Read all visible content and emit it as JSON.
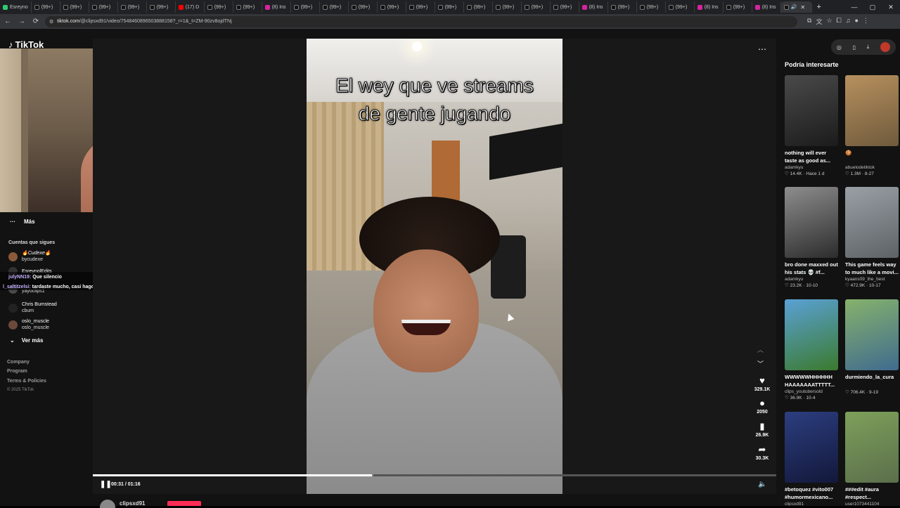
{
  "browser": {
    "tabs": [
      {
        "label": "Esreyno",
        "fav": "#2ecc71"
      },
      {
        "label": "(99+)",
        "fav": "#000"
      },
      {
        "label": "(99+)",
        "fav": "#000"
      },
      {
        "label": "(99+)",
        "fav": "#000"
      },
      {
        "label": "(99+)",
        "fav": "#000"
      },
      {
        "label": "(99+)",
        "fav": "#000"
      },
      {
        "label": "(17) D",
        "fav": "#ff0000"
      },
      {
        "label": "(99+)",
        "fav": "#000"
      },
      {
        "label": "(99+)",
        "fav": "#000"
      },
      {
        "label": "(8) Ins",
        "fav": "#d6249f"
      },
      {
        "label": "(99+)",
        "fav": "#000"
      },
      {
        "label": "(99+)",
        "fav": "#000"
      },
      {
        "label": "(99+)",
        "fav": "#000"
      },
      {
        "label": "(99+)",
        "fav": "#000"
      },
      {
        "label": "(99+)",
        "fav": "#000"
      },
      {
        "label": "(99+)",
        "fav": "#000"
      },
      {
        "label": "(99+)",
        "fav": "#000"
      },
      {
        "label": "(99+)",
        "fav": "#000"
      },
      {
        "label": "(99+)",
        "fav": "#000"
      },
      {
        "label": "(99+)",
        "fav": "#000"
      },
      {
        "label": "(8) Ins",
        "fav": "#d6249f"
      },
      {
        "label": "(99+)",
        "fav": "#000"
      },
      {
        "label": "(99+)",
        "fav": "#000"
      },
      {
        "label": "(99+)",
        "fav": "#000"
      },
      {
        "label": "(8) Ins",
        "fav": "#d6249f"
      },
      {
        "label": "(99+)",
        "fav": "#000"
      },
      {
        "label": "(8) Ins",
        "fav": "#d6249f"
      }
    ],
    "url_host": "tiktok.com",
    "url_path": "/@clipsxd91/video/7548460896503888158?_r=1&_t=ZM-90zv8ojdTNj",
    "nav_icons": [
      "back-icon",
      "forward-icon",
      "reload-icon",
      "site-info-icon"
    ]
  },
  "left_nav": {
    "logo_text": "TikTok",
    "more_label": "Más",
    "following_title": "Cuentas que sigues",
    "accounts": [
      {
        "name": "🔥Cudexe🔥",
        "uid": "bycudexe"
      },
      {
        "name": "EsreynolEdits",
        "uid": "esreynoledits"
      },
      {
        "name": "Chris Bumstead",
        "uid": "cbum"
      },
      {
        "name": "oslo_muscle",
        "uid": "oslo_muscle"
      }
    ],
    "hidden_uid": "yayoclips1",
    "see_more_label": "Ver más",
    "footer": [
      "Company",
      "Program",
      "Terms & Policies"
    ],
    "copyright": "© 2025 TikTok"
  },
  "chat": [
    {
      "user": "julyNN19:",
      "msg": "Que silencio"
    },
    {
      "user": "l_saltitzelsi:",
      "msg": "tardaste mucho, casi hago algo de mi vida"
    }
  ],
  "video": {
    "caption_line1": "El wey que ve streams",
    "caption_line2": "de gente jugando",
    "time_label": "00:31 / 01:16",
    "progress_fraction": 0.408,
    "buffer_fraction": 0.41,
    "author": "clipsxd91"
  },
  "actions": {
    "likes": "329.1K",
    "comments": "2050",
    "saves": "26.9K",
    "shares": "30.3K"
  },
  "rail": {
    "title": "Podría interesarte",
    "cards": [
      {
        "title": "nothing will ever taste as good as...",
        "user": "adamkyu",
        "likes": "14.4K",
        "date": "Hace 1 d",
        "c1": "#4a4a4a",
        "c2": "#1b1b1b"
      },
      {
        "title": "🍪",
        "user": "abuelodetiktok",
        "likes": "1.3M",
        "date": "8-27",
        "c1": "#b7905e",
        "c2": "#6f5a3c"
      },
      {
        "title": "bro done maxxed out his stats 💀 #f...",
        "user": "adamkyu",
        "likes": "23.2K",
        "date": "10-10",
        "c1": "#8d8d8d",
        "c2": "#2c2c2c"
      },
      {
        "title": "This game feels way to much like a movi...",
        "user": "kyaans09_the_best",
        "likes": "472.9K",
        "date": "10-17",
        "c1": "#9aa0a6",
        "c2": "#5d6266"
      },
      {
        "title": "WWWWWHHHHHH HAAAAAAATTTTT...",
        "user": "clips_youtubersold",
        "likes": "36.9K",
        "date": "10-4",
        "c1": "#5aa1d6",
        "c2": "#3b7a2d"
      },
      {
        "title": "durmiendo_la_cura",
        "user": "",
        "likes": "706.4K",
        "date": "9-19",
        "c1": "#86b26c",
        "c2": "#3f6b8f"
      },
      {
        "title": "#betoquez #vito007 #humormexicano...",
        "user": "clipsxd91",
        "likes": "",
        "date": "",
        "c1": "#2c3e80",
        "c2": "#13183a"
      },
      {
        "title": "###edit #aura #respect...",
        "user": "user1073441104",
        "likes": "",
        "date": "",
        "c1": "#7da05a",
        "c2": "#5b6e4b"
      }
    ]
  }
}
